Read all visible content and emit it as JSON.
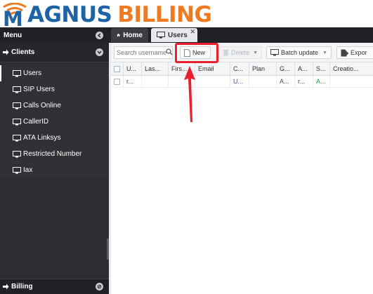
{
  "logo": {
    "part1": "AGNUS",
    "part2": "BILLING",
    "m": "M"
  },
  "sidebar": {
    "menu_label": "Menu",
    "section_label": "Clients",
    "items": [
      {
        "label": "Users"
      },
      {
        "label": "SIP Users"
      },
      {
        "label": "Calls Online"
      },
      {
        "label": "CallerID"
      },
      {
        "label": "ATA Linksys"
      },
      {
        "label": "Restricted Number"
      },
      {
        "label": "Iax"
      }
    ],
    "footer_label": "Billing"
  },
  "tabs": {
    "home": "Home",
    "users": "Users",
    "close": "✕"
  },
  "toolbar": {
    "search_placeholder": "Search username",
    "new_label": "New",
    "delete_label": "Delete",
    "batch_label": "Batch update",
    "export_label": "Expor"
  },
  "grid": {
    "columns": [
      "U...",
      "Las...",
      "Firs...",
      "Email",
      "C...",
      "Plan",
      "G...",
      "A...",
      "S...",
      "Creatio..."
    ],
    "row": [
      "r...",
      "",
      "",
      "",
      "U...",
      "",
      "A...",
      "r...",
      "A...",
      ""
    ]
  },
  "colors": {
    "accent_red": "#e8202e",
    "logo_blue": "#1e63a6",
    "logo_orange": "#ee7a21"
  }
}
